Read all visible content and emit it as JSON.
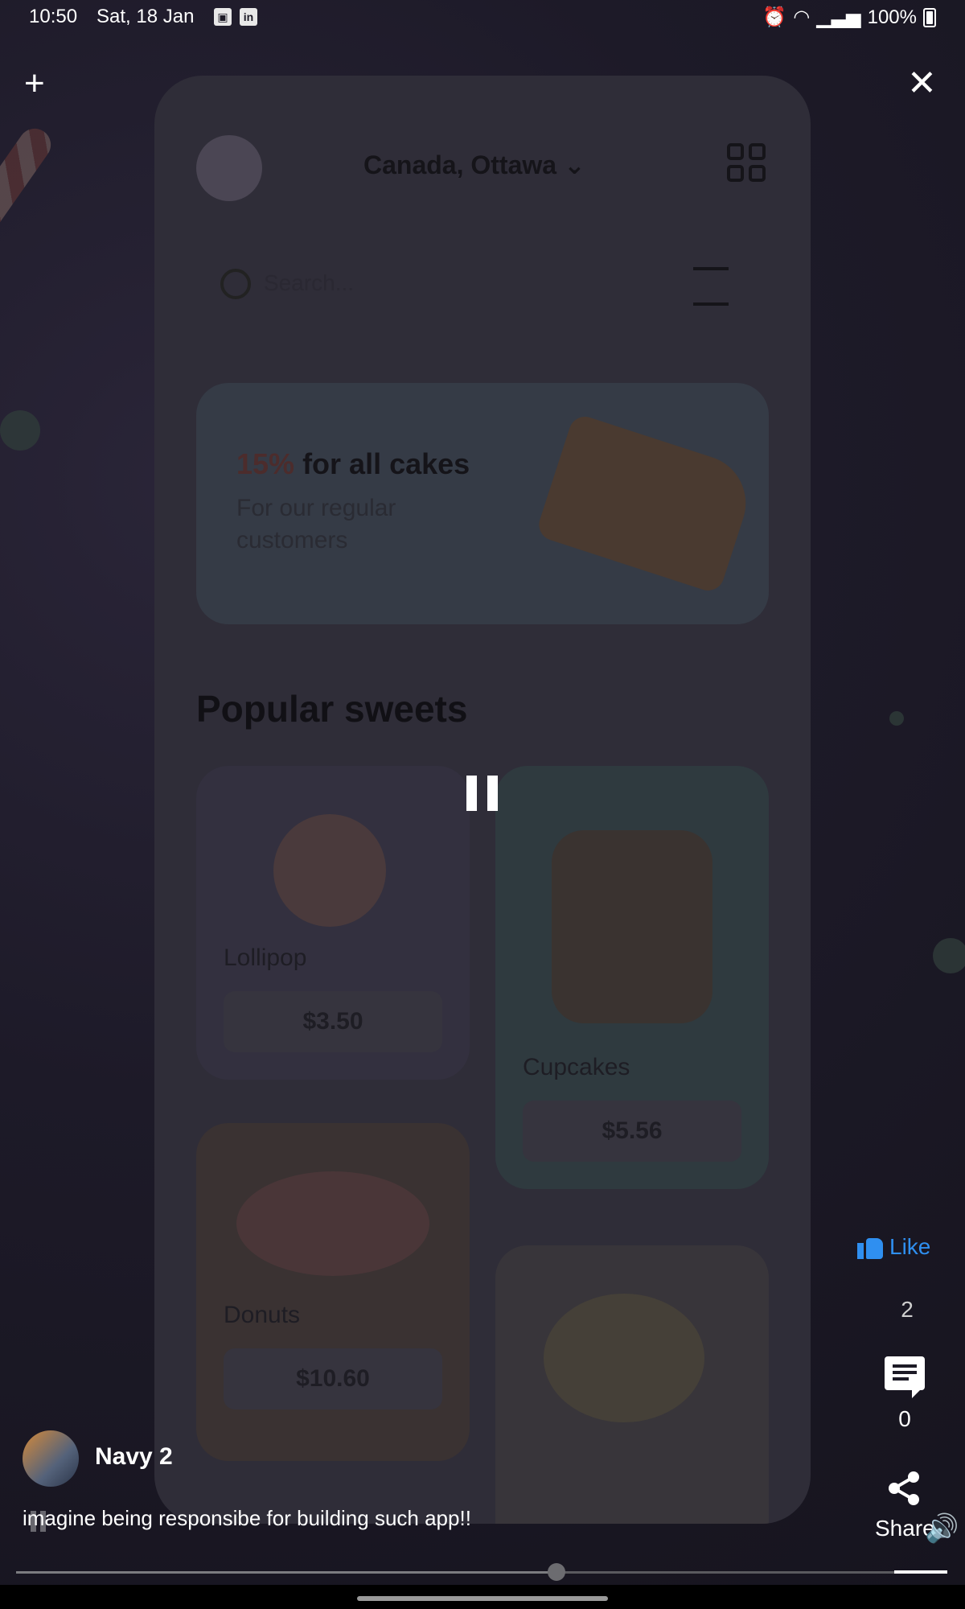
{
  "status_bar": {
    "time": "10:50",
    "date": "Sat, 18 Jan",
    "linkedin_label": "in",
    "battery": "100%"
  },
  "top_controls": {
    "add_symbol": "+",
    "close_symbol": "✕"
  },
  "app_preview": {
    "location": "Canada, Ottawa ⌄",
    "search_placeholder": "Search...",
    "banner_percent": "15%",
    "banner_title": " for all cakes",
    "banner_subtitle": "For our regular customers",
    "section_title": "Popular sweets",
    "products": [
      {
        "name": "Lollipop",
        "price": "$3.50"
      },
      {
        "name": "Cupcakes",
        "price": "$5.56"
      },
      {
        "name": "Donuts",
        "price": "$10.60"
      }
    ]
  },
  "post": {
    "author": "Navy 2",
    "caption": "imagine being responsibe for building such app!!",
    "like_label": "Like",
    "like_count": "2",
    "comment_count": "0",
    "share_label": "Share",
    "progress": 0.58
  },
  "colors": {
    "like_blue": "#2f8ff0",
    "background": "#1c1a26"
  },
  "icons": [
    "plus-icon",
    "close-icon",
    "pause-icon",
    "like-icon",
    "comment-icon",
    "share-icon",
    "volume-icon",
    "alarm-icon",
    "wifi-icon",
    "signal-icon",
    "battery-icon"
  ]
}
